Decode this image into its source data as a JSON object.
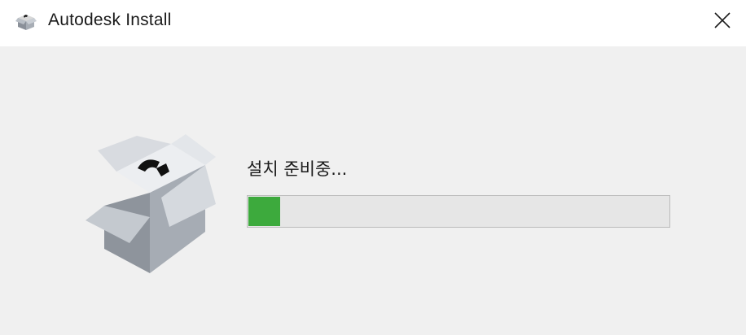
{
  "window": {
    "title": "Autodesk Install",
    "app_icon": "autodesk-install-box-icon",
    "close_icon": "close-icon"
  },
  "install": {
    "status_text": "설치 준비중...",
    "progress_fraction": 0.075,
    "progress_color": "#3daa3d",
    "illustration": "open-box-icon"
  }
}
